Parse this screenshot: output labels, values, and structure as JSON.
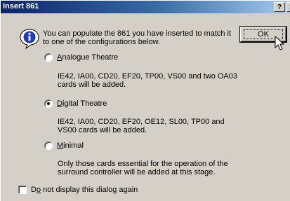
{
  "window": {
    "title": "Insert 861",
    "help_label": "?",
    "close_label": "×"
  },
  "message": "You can populate the 861 you have inserted  to match it to one of the configurations below.",
  "ok_label": "OK",
  "options": [
    {
      "key": "A",
      "label_rest": "nalogue Theatre",
      "selected": false,
      "description": "IE42, IA00, CD20, EF20, TP00, VS00 and two OA03 cards will be added."
    },
    {
      "key": "D",
      "label_rest": "igital Theatre",
      "selected": true,
      "description": "IE42, IA00, CD20, EF20, OE12, SL00, TP00 and VS00 cards will be added."
    },
    {
      "key": "M",
      "label_rest": "inimal",
      "selected": false,
      "description": "Only those cards essential for the operation of the surround controller will be added at this stage."
    }
  ],
  "dont_show": {
    "pre": "D",
    "key": "o",
    "post": " not display this dialog again",
    "checked": false
  }
}
